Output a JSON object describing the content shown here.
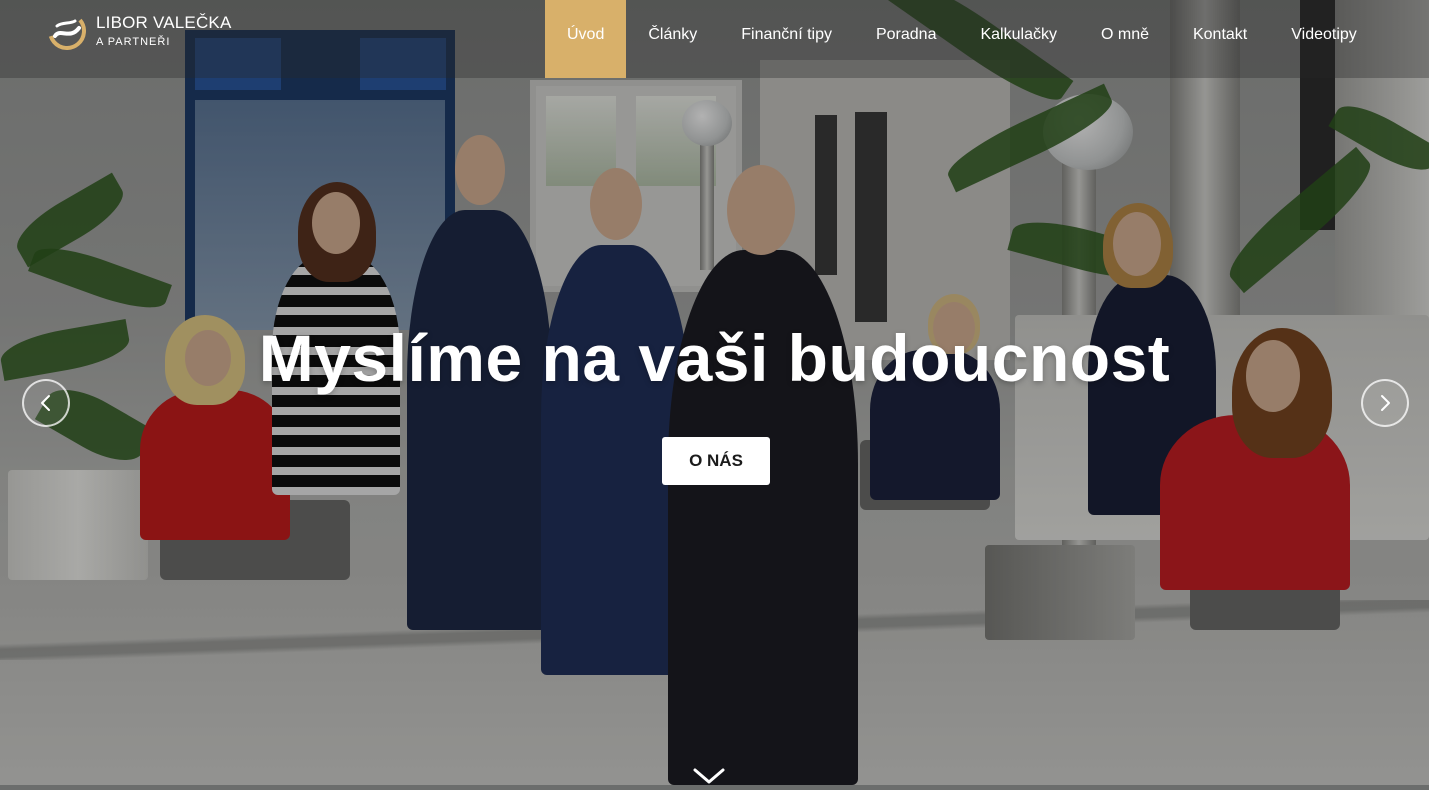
{
  "brand": {
    "name_line1": "LIBOR VALEČKA",
    "name_line2": "A PARTNEŘI",
    "logo_icon": "swirl-logo-icon",
    "accent_color": "#d8b06a"
  },
  "nav": {
    "items": [
      {
        "label": "Úvod",
        "active": true
      },
      {
        "label": "Články",
        "active": false
      },
      {
        "label": "Finanční tipy",
        "active": false
      },
      {
        "label": "Poradna",
        "active": false
      },
      {
        "label": "Kalkulačky",
        "active": false
      },
      {
        "label": "O mně",
        "active": false
      },
      {
        "label": "Kontakt",
        "active": false
      },
      {
        "label": "Videotipy",
        "active": false
      }
    ]
  },
  "hero": {
    "headline": "Myslíme na vaši budoucnost",
    "cta_label": "O NÁS",
    "prev_icon": "chevron-left-icon",
    "next_icon": "chevron-right-icon",
    "scroll_icon": "chevron-down-icon"
  }
}
